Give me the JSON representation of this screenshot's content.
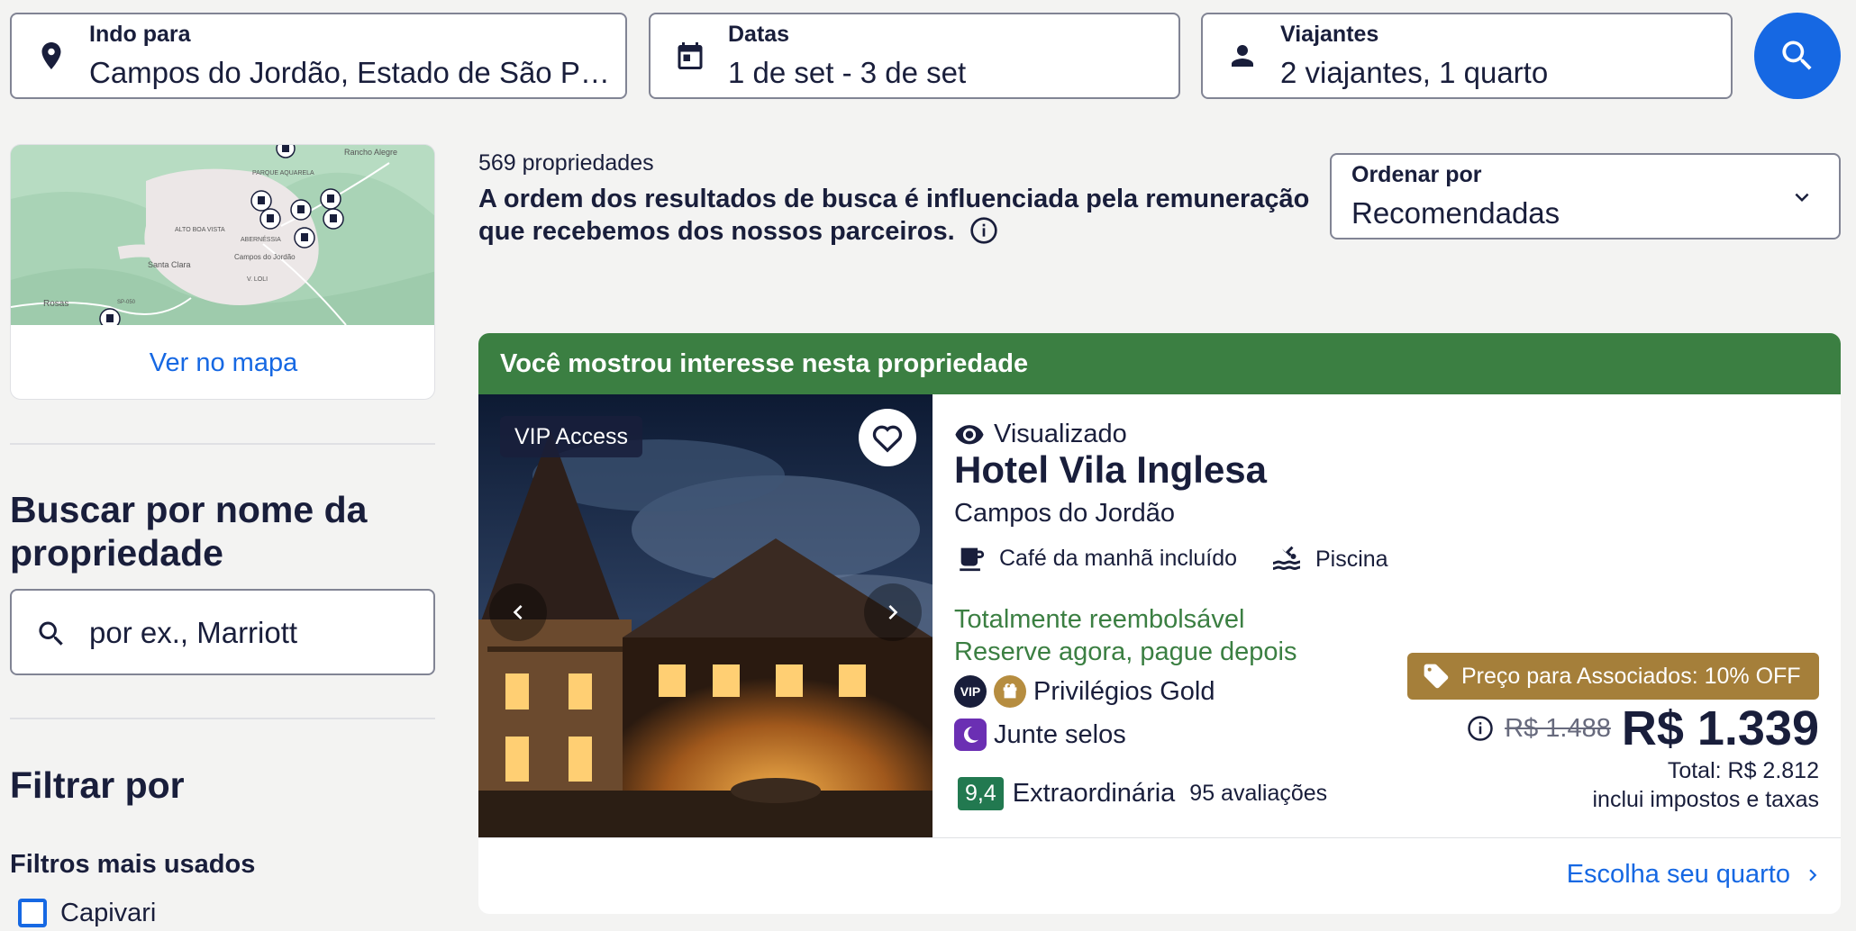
{
  "search": {
    "destination": {
      "label": "Indo para",
      "value": "Campos do Jordão, Estado de São Pa..."
    },
    "dates": {
      "label": "Datas",
      "value": "1 de set - 3 de set"
    },
    "travelers": {
      "label": "Viajantes",
      "value": "2 viajantes, 1 quarto"
    }
  },
  "map": {
    "link": "Ver no mapa",
    "places": [
      "PARQUE AQUARELA",
      "Rancho Alegre",
      "ALTO BOA VISTA",
      "ABERNÉSSIA",
      "Campos do Jordão",
      "Santa Clara",
      "V. LOLI",
      "Rosas",
      "SP-050"
    ]
  },
  "sidebar": {
    "search_heading": "Buscar por nome da propriedade",
    "search_placeholder": "por ex., Marriott",
    "filter_heading": "Filtrar por",
    "popular_filters_heading": "Filtros mais usados",
    "filters": [
      {
        "label": "Capivari",
        "checked": false
      }
    ]
  },
  "results": {
    "count": "569 propriedades",
    "disclaimer": "A ordem dos resultados de busca é influenciada pela remuneração que recebemos dos nossos parceiros.",
    "sort": {
      "label": "Ordenar por",
      "value": "Recomendadas"
    }
  },
  "property": {
    "banner": "Você mostrou interesse nesta propriedade",
    "vip_tag": "VIP Access",
    "viewed": "Visualizado",
    "name": "Hotel Vila Inglesa",
    "location": "Campos do Jordão",
    "amenities": [
      "Café da manhã incluído",
      "Piscina"
    ],
    "refundable": "Totalmente reembolsável",
    "pay_later": "Reserve agora, pague depois",
    "vip_badge": "VIP",
    "loyalty": "Privilégios Gold",
    "stamps": "Junte selos",
    "rating": {
      "score": "9,4",
      "label": "Extraordinária",
      "reviews": "95 avaliações"
    },
    "member_deal": "Preço para Associados: 10% OFF",
    "old_price": "R$ 1.488",
    "price": "R$ 1.339",
    "total": "Total: R$ 2.812",
    "taxes": "inclui impostos e taxas",
    "cta": "Escolha seu quarto"
  },
  "colors": {
    "accent": "#1668e3",
    "banner_green": "#3b7f42",
    "rating_green": "#227950",
    "member_gold": "#a57f3a"
  }
}
